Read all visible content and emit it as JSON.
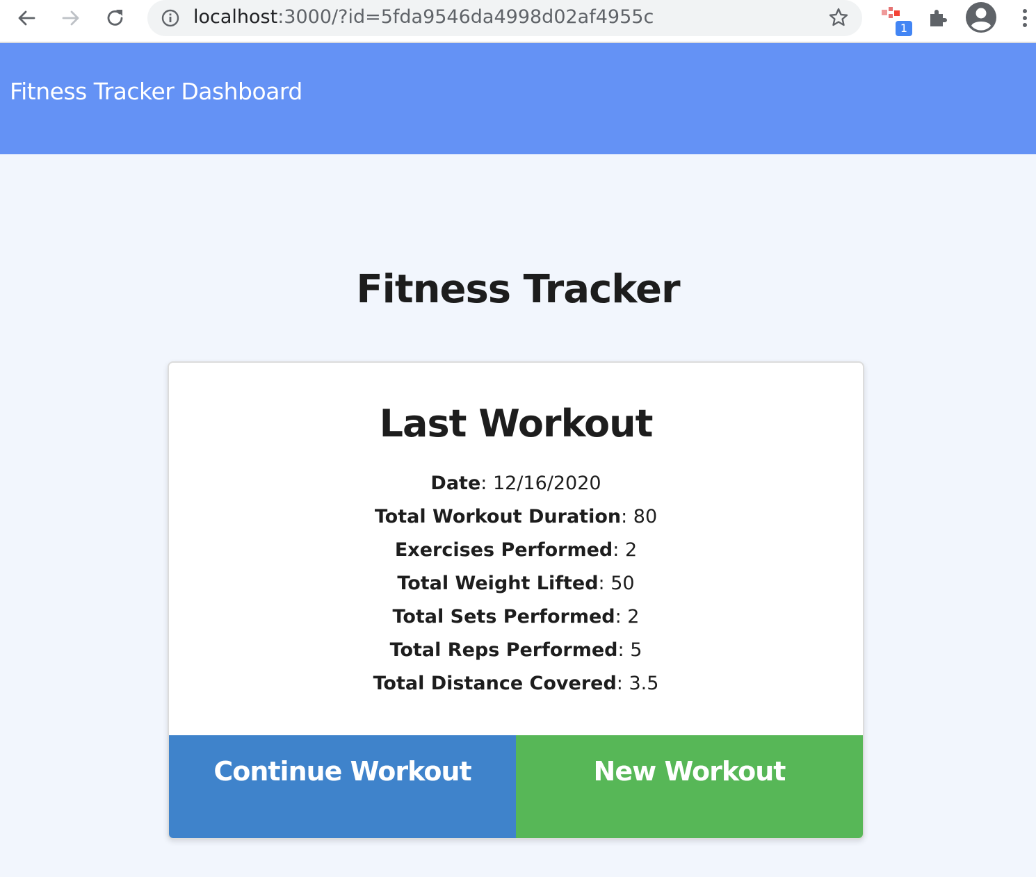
{
  "browser": {
    "url_host": "localhost",
    "url_rest": ":3000/?id=5fda9546da4998d02af4955c",
    "extension_badge": "1",
    "icons": [
      "back-arrow-icon",
      "forward-arrow-icon",
      "reload-icon",
      "site-info-icon",
      "bookmark-star-icon",
      "extension-icon",
      "puzzle-icon",
      "profile-icon",
      "more-menu-icon"
    ]
  },
  "header": {
    "brand": "Fitness Tracker Dashboard"
  },
  "main": {
    "title": "Fitness Tracker",
    "card": {
      "title": "Last Workout",
      "stats": [
        {
          "label": "Date",
          "value": "12/16/2020"
        },
        {
          "label": "Total Workout Duration",
          "value": "80"
        },
        {
          "label": "Exercises Performed",
          "value": "2"
        },
        {
          "label": "Total Weight Lifted",
          "value": "50"
        },
        {
          "label": "Total Sets Performed",
          "value": "2"
        },
        {
          "label": "Total Reps Performed",
          "value": "5"
        },
        {
          "label": "Total Distance Covered",
          "value": "3.5"
        }
      ],
      "continue_label": "Continue Workout",
      "new_label": "New Workout"
    }
  },
  "colors": {
    "header_bg": "#6492f5",
    "page_bg": "#f2f6fd",
    "continue_bg": "#3f83cb",
    "new_bg": "#57b757"
  }
}
